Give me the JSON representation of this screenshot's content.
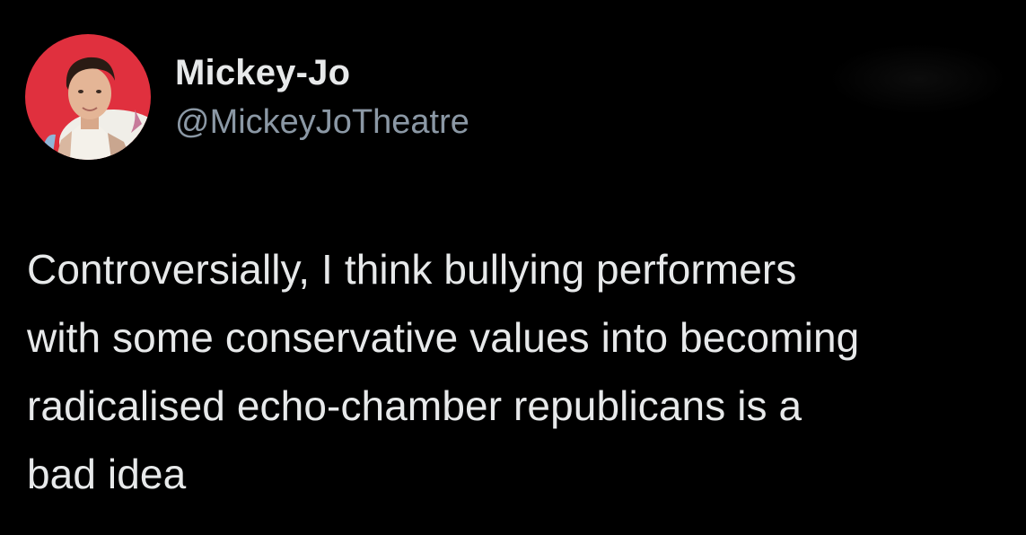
{
  "tweet": {
    "display_name": "Mickey-Jo",
    "handle": "@MickeyJoTheatre",
    "text_lines": [
      "Controversially, I think bullying performers",
      "with some conservative values into becoming",
      "radicalised echo-chamber republicans is a",
      "bad idea"
    ]
  },
  "colors": {
    "background": "#000000",
    "primary_text": "#e7e9ea",
    "secondary_text": "#8b98a5",
    "avatar_background": "#e0303e"
  }
}
